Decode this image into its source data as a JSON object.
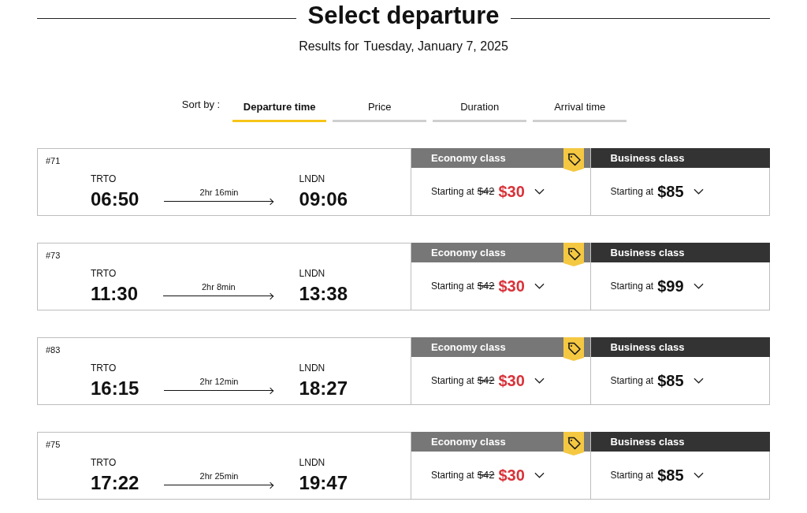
{
  "title": "Select departure",
  "results": {
    "label": "Results for",
    "date": "Tuesday, January 7, 2025"
  },
  "sort": {
    "label": "Sort by :",
    "tabs": [
      {
        "label": "Departure time",
        "selected": true
      },
      {
        "label": "Price",
        "selected": false
      },
      {
        "label": "Duration",
        "selected": false
      },
      {
        "label": "Arrival time",
        "selected": false
      }
    ]
  },
  "trips": [
    {
      "number": "#71",
      "origin": "TRTO",
      "departure": "06:50",
      "duration": "2hr 16min",
      "destination": "LNDN",
      "arrival": "09:06",
      "fares": [
        {
          "kind": "economy",
          "class": "Economy class",
          "deal": true,
          "starting": "Starting at",
          "old_price": "$42",
          "price": "$30"
        },
        {
          "kind": "business",
          "class": "Business class",
          "deal": false,
          "starting": "Starting at",
          "price": "$85"
        }
      ]
    },
    {
      "number": "#73",
      "origin": "TRTO",
      "departure": "11:30",
      "duration": "2hr 8min",
      "destination": "LNDN",
      "arrival": "13:38",
      "fares": [
        {
          "kind": "economy",
          "class": "Economy class",
          "deal": true,
          "starting": "Starting at",
          "old_price": "$42",
          "price": "$30"
        },
        {
          "kind": "business",
          "class": "Business class",
          "deal": false,
          "starting": "Starting at",
          "price": "$99"
        }
      ]
    },
    {
      "number": "#83",
      "origin": "TRTO",
      "departure": "16:15",
      "duration": "2hr 12min",
      "destination": "LNDN",
      "arrival": "18:27",
      "fares": [
        {
          "kind": "economy",
          "class": "Economy class",
          "deal": true,
          "starting": "Starting at",
          "old_price": "$42",
          "price": "$30"
        },
        {
          "kind": "business",
          "class": "Business class",
          "deal": false,
          "starting": "Starting at",
          "price": "$85"
        }
      ]
    },
    {
      "number": "#75",
      "origin": "TRTO",
      "departure": "17:22",
      "duration": "2hr 25min",
      "destination": "LNDN",
      "arrival": "19:47",
      "fares": [
        {
          "kind": "economy",
          "class": "Economy class",
          "deal": true,
          "starting": "Starting at",
          "old_price": "$42",
          "price": "$30"
        },
        {
          "kind": "business",
          "class": "Business class",
          "deal": false,
          "starting": "Starting at",
          "price": "$85"
        }
      ]
    }
  ]
}
